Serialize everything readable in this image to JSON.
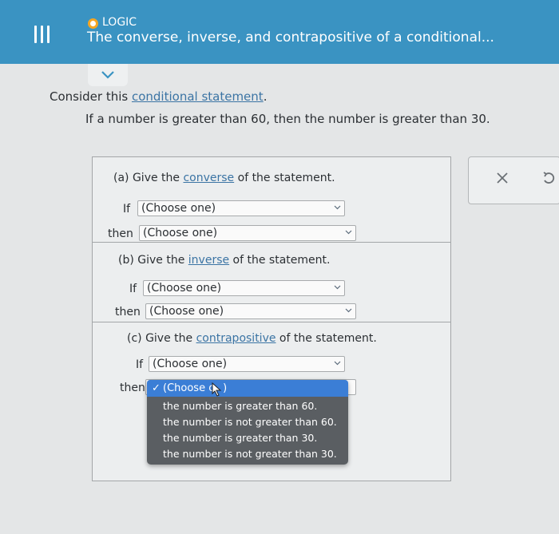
{
  "header": {
    "topic": "LOGIC",
    "title": "The converse, inverse, and contrapositive of a conditional..."
  },
  "intro": {
    "prefix": "Consider this ",
    "link": "conditional statement",
    "suffix": "."
  },
  "statement": "If a number is greater than 60, then the number is greater than 30.",
  "questions": {
    "a": {
      "prefix": "(a) Give the ",
      "link": "converse",
      "suffix": " of the statement."
    },
    "b": {
      "prefix": "(b) Give the ",
      "link": "inverse",
      "suffix": " of the statement."
    },
    "c": {
      "prefix": "(c) Give the ",
      "link": "contrapositive",
      "suffix": " of the statement."
    }
  },
  "labels": {
    "if": "If",
    "then": "then"
  },
  "dropdown": {
    "placeholder": "(Choose one)",
    "selected": "(Choose o",
    "selected_end": ")",
    "options": [
      "the number is greater than 60.",
      "the number is not greater than 60.",
      "the number is greater than 30.",
      "the number is not greater than 30."
    ]
  },
  "icons": [
    "menu-icon",
    "chevron-down-icon",
    "close-icon",
    "undo-icon",
    "check-icon",
    "cursor-icon"
  ],
  "colors": {
    "header": "#3a93c2",
    "link": "#3b74a4",
    "selected_option": "#3b7ed6",
    "dropdown_menu": "#5a5e62"
  }
}
